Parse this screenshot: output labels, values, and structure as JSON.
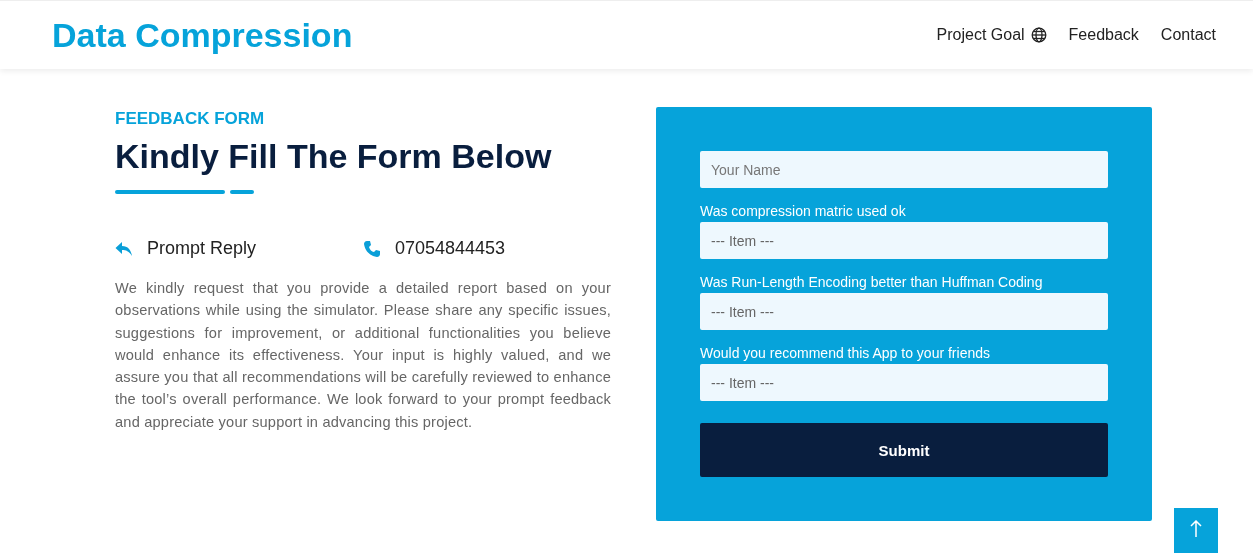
{
  "header": {
    "logo": "Data Compression",
    "nav": [
      {
        "label": "Project Goal",
        "kind": "iconlink"
      },
      {
        "label": "Feedback",
        "kind": "link"
      },
      {
        "label": "Contact",
        "kind": "link"
      }
    ]
  },
  "intro": {
    "eyebrow": "FEEDBACK FORM",
    "title": "Kindly Fill The Form Below",
    "contacts": [
      {
        "kind": "reply",
        "text": "Prompt Reply"
      },
      {
        "kind": "phone",
        "text": "07054844453"
      }
    ],
    "paragraph": "We kindly request that you provide a detailed report based on your observations while using the simulator. Please share any specific issues, suggestions for improvement, or additional functionalities you believe would enhance its effectiveness. Your input is highly valued, and we assure you that all recommendations will be carefully reviewed to enhance the tool’s overall performance. We look forward to your prompt feedback and appreciate your support in advancing this project."
  },
  "form": {
    "name_field": {
      "placeholder": "Your Name"
    },
    "questions": [
      {
        "label": "Was compression matric used ok",
        "value": "--- Item ---"
      },
      {
        "label": "Was Run-Length Encoding better than Huffman Coding",
        "value": "--- Item ---"
      },
      {
        "label": "Would you recommend this App to your friends",
        "value": "--- Item ---"
      }
    ],
    "submit": "Submit"
  }
}
